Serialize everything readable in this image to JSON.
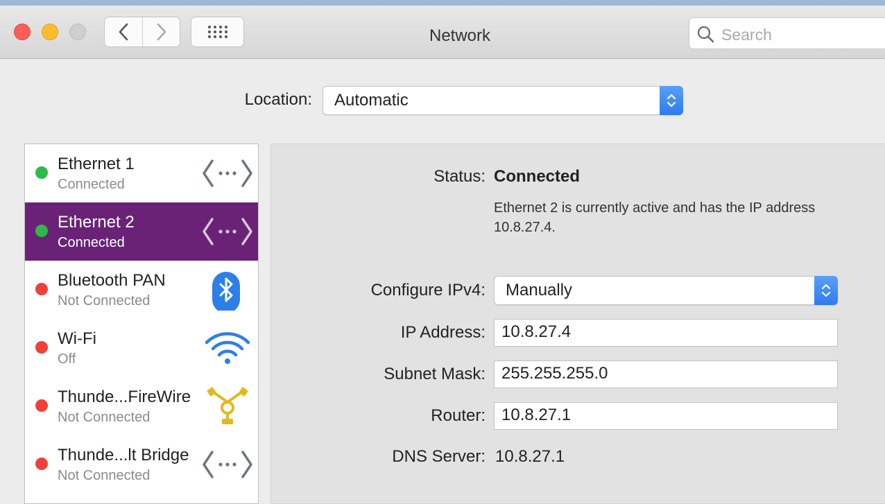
{
  "window": {
    "title": "Network"
  },
  "search": {
    "placeholder": "Search"
  },
  "location": {
    "label": "Location:",
    "value": "Automatic"
  },
  "services": [
    {
      "name": "Ethernet 1",
      "status": "Connected",
      "dot_color": "#2fb84a",
      "icon": "ethernet-icon",
      "selected": false
    },
    {
      "name": "Ethernet 2",
      "status": "Connected",
      "dot_color": "#2fb84a",
      "icon": "ethernet-icon",
      "selected": true
    },
    {
      "name": "Bluetooth PAN",
      "status": "Not Connected",
      "dot_color": "#f0403a",
      "icon": "bluetooth-icon",
      "selected": false
    },
    {
      "name": "Wi-Fi",
      "status": "Off",
      "dot_color": "#f0403a",
      "icon": "wifi-icon",
      "selected": false
    },
    {
      "name": "Thunde...FireWire",
      "status": "Not Connected",
      "dot_color": "#f0403a",
      "icon": "firewire-icon",
      "selected": false
    },
    {
      "name": "Thunde...lt Bridge",
      "status": "Not Connected",
      "dot_color": "#f0403a",
      "icon": "ethernet-icon",
      "selected": false
    }
  ],
  "detail": {
    "status_label": "Status:",
    "status_value": "Connected",
    "status_description": "Ethernet 2 is currently active and has the IP address 10.8.27.4.",
    "configure_label": "Configure IPv4:",
    "configure_value": "Manually",
    "ip_label": "IP Address:",
    "ip_value": "10.8.27.4",
    "subnet_label": "Subnet Mask:",
    "subnet_value": "255.255.255.0",
    "router_label": "Router:",
    "router_value": "10.8.27.1",
    "dns_label": "DNS Server:",
    "dns_value": "10.8.27.1"
  },
  "colors": {
    "selection": "#6a2277",
    "accent_blue": "#2d7bf0",
    "status_green": "#2fb84a",
    "status_red": "#f0403a"
  }
}
